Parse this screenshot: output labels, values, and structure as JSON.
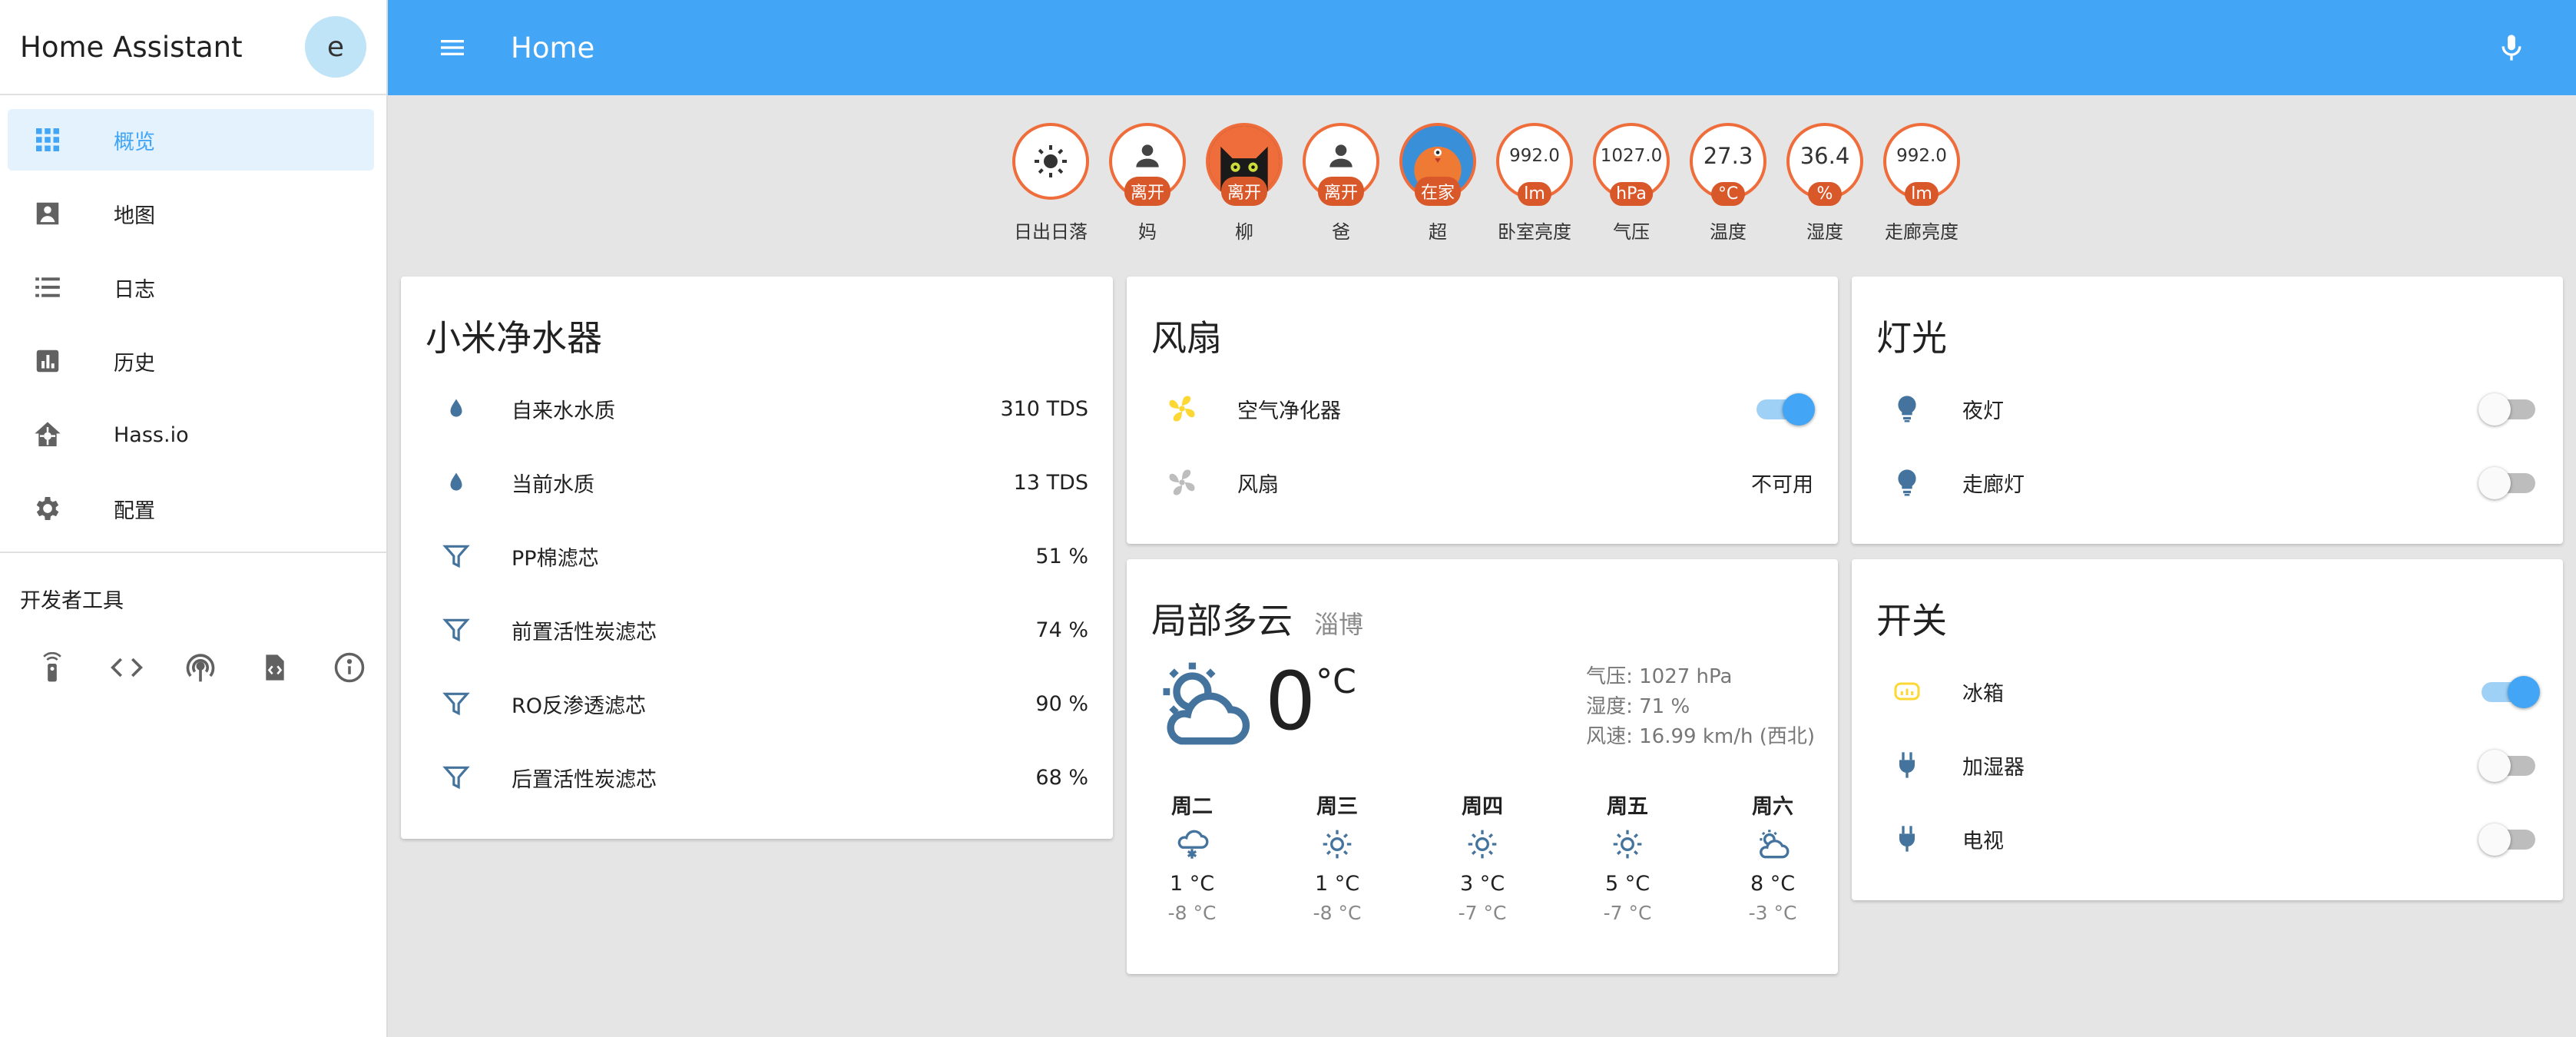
{
  "app": {
    "title": "Home Assistant",
    "avatar_letter": "e",
    "page_title": "Home"
  },
  "sidebar": {
    "items": [
      {
        "label": "概览",
        "icon": "grid-icon",
        "active": true
      },
      {
        "label": "地图",
        "icon": "map-icon"
      },
      {
        "label": "日志",
        "icon": "list-icon"
      },
      {
        "label": "历史",
        "icon": "chart-icon"
      },
      {
        "label": "Hass.io",
        "icon": "hassio-icon"
      },
      {
        "label": "配置",
        "icon": "gear-icon"
      }
    ],
    "dev_tools_title": "开发者工具",
    "dev_tools": [
      "remote-icon",
      "code-icon",
      "broadcast-icon",
      "file-code-icon",
      "info-icon"
    ]
  },
  "badges": [
    {
      "name": "日出日落",
      "value": "",
      "tag": ""
    },
    {
      "name": "妈",
      "value": "",
      "tag": "离开"
    },
    {
      "name": "柳",
      "value": "",
      "tag": "离开"
    },
    {
      "name": "爸",
      "value": "",
      "tag": "离开"
    },
    {
      "name": "超",
      "value": "",
      "tag": "在家"
    },
    {
      "name": "卧室亮度",
      "value": "992.0",
      "tag": "lm"
    },
    {
      "name": "气压",
      "value": "1027.0",
      "tag": "hPa"
    },
    {
      "name": "温度",
      "value": "27.3",
      "tag": "°C"
    },
    {
      "name": "湿度",
      "value": "36.4",
      "tag": "%"
    },
    {
      "name": "走廊亮度",
      "value": "992.0",
      "tag": "lm"
    }
  ],
  "water_card": {
    "title": "小米净水器",
    "rows": [
      {
        "name": "自来水水质",
        "value": "310 TDS",
        "icon": "water-drop-icon"
      },
      {
        "name": "当前水质",
        "value": "13 TDS",
        "icon": "water-drop-icon"
      },
      {
        "name": "PP棉滤芯",
        "value": "51 %",
        "icon": "filter-icon"
      },
      {
        "name": "前置活性炭滤芯",
        "value": "74 %",
        "icon": "filter-icon"
      },
      {
        "name": "RO反渗透滤芯",
        "value": "90 %",
        "icon": "filter-icon"
      },
      {
        "name": "后置活性炭滤芯",
        "value": "68 %",
        "icon": "filter-icon"
      }
    ]
  },
  "fan_card": {
    "title": "风扇",
    "rows": [
      {
        "name": "空气净化器",
        "state": "on"
      },
      {
        "name": "风扇",
        "value": "不可用"
      }
    ]
  },
  "light_card": {
    "title": "灯光",
    "rows": [
      {
        "name": "夜灯",
        "state": "off"
      },
      {
        "name": "走廊灯",
        "state": "off"
      }
    ]
  },
  "weather_card": {
    "title": "局部多云",
    "location": "淄博",
    "temp": "0",
    "unit": "°C",
    "pressure": "气压: 1027 hPa",
    "humidity": "湿度: 71 %",
    "wind": "风速: 16.99 km/h (西北)",
    "forecast": [
      {
        "day": "周二",
        "hi": "1 °C",
        "lo": "-8 °C",
        "icon": "snow-icon"
      },
      {
        "day": "周三",
        "hi": "1 °C",
        "lo": "-8 °C",
        "icon": "sun-icon"
      },
      {
        "day": "周四",
        "hi": "3 °C",
        "lo": "-7 °C",
        "icon": "sun-icon"
      },
      {
        "day": "周五",
        "hi": "5 °C",
        "lo": "-7 °C",
        "icon": "sun-icon"
      },
      {
        "day": "周六",
        "hi": "8 °C",
        "lo": "-3 °C",
        "icon": "partly-cloudy-icon"
      }
    ]
  },
  "switch_card": {
    "title": "开关",
    "rows": [
      {
        "name": "冰箱",
        "state": "on"
      },
      {
        "name": "加湿器",
        "state": "off"
      },
      {
        "name": "电视",
        "state": "off"
      }
    ]
  },
  "colors": {
    "primary": "#42a5f5",
    "badge_border": "#ef6c3b",
    "badge_tag": "#d9582a",
    "icon": "#44739e",
    "active_icon": "#fdd835"
  }
}
